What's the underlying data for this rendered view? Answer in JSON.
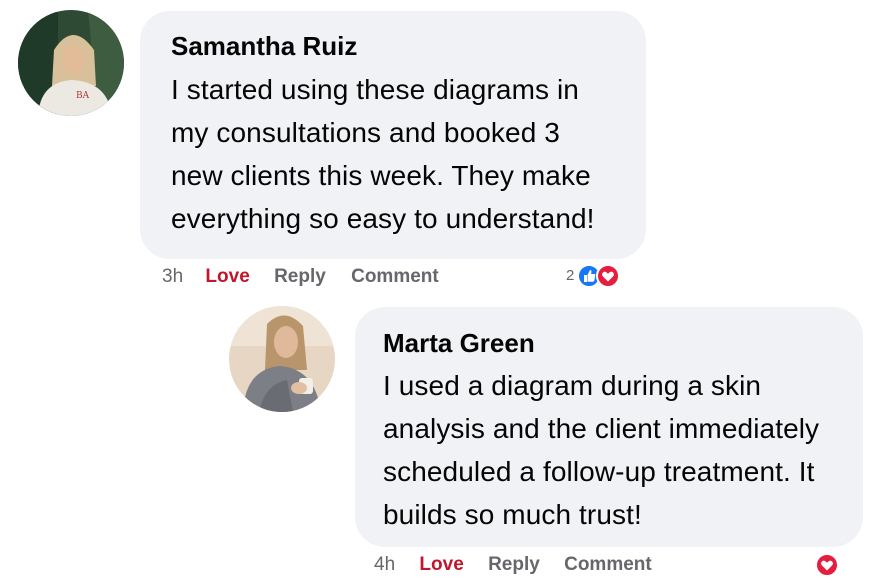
{
  "comments": [
    {
      "author": "Samantha Ruiz",
      "text": "I started using these diagrams in my consultations and booked 3 new clients this week. They make everything so easy to understand!",
      "time": "3h",
      "love_label": "Love",
      "reply_label": "Reply",
      "comment_label": "Comment",
      "reaction_count": "2",
      "reactions": [
        "like-icon",
        "heart-icon"
      ]
    },
    {
      "author": "Marta Green",
      "text": "I used a diagram during a skin analysis and the client immediately scheduled a follow-up treatment. It builds so much trust!",
      "time": "4h",
      "love_label": "Love",
      "reply_label": "Reply",
      "comment_label": "Comment",
      "reactions": [
        "heart-icon"
      ]
    }
  ],
  "colors": {
    "bubble": "#f0f2f5",
    "love": "#c0172f",
    "like_blue": "#1877f2",
    "heart_red": "#e41e3f",
    "meta": "#65676b"
  }
}
